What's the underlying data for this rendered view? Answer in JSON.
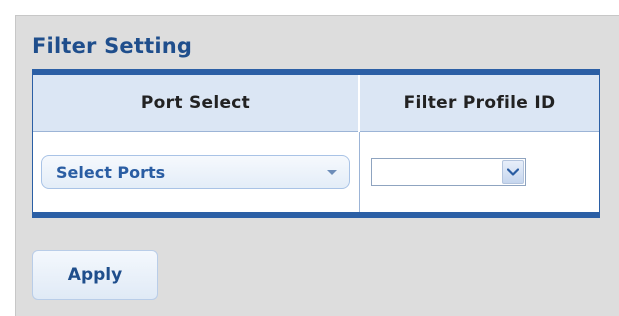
{
  "section": {
    "title": "Filter Setting"
  },
  "table": {
    "headers": [
      "Port Select",
      "Filter Profile ID"
    ],
    "port_select_value": "Select Ports",
    "filter_profile_value": ""
  },
  "actions": {
    "apply_label": "Apply"
  },
  "icons": {
    "port_dropdown": "caret-down-icon",
    "profile_dropdown": "chevron-down-icon"
  },
  "colors": {
    "title": "#1f4e8c",
    "table_border": "#2b5fa5",
    "header_bg": "#dbe6f4",
    "panel_bg": "#dddddd"
  }
}
